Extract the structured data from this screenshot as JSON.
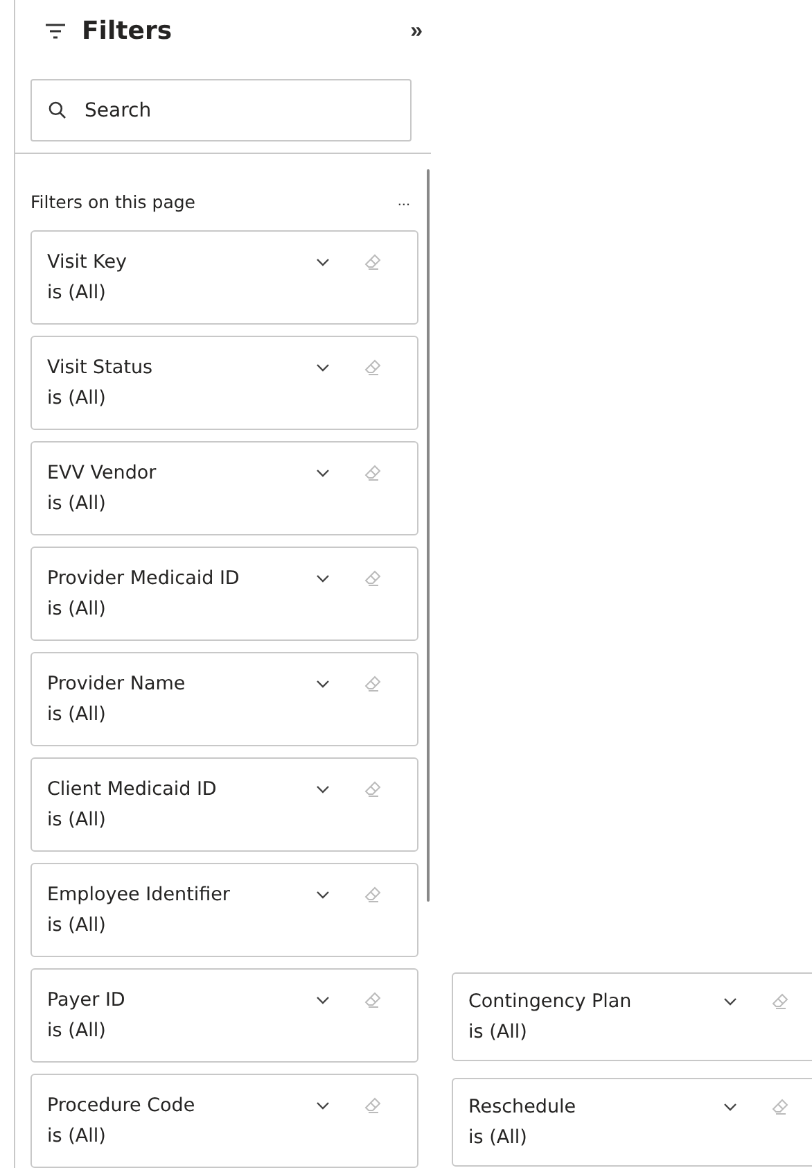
{
  "header": {
    "title": "Filters",
    "collapse": "»"
  },
  "search": {
    "placeholder": "Search"
  },
  "section": {
    "label": "Filters on this page",
    "more": "..."
  },
  "filters": [
    {
      "name": "Visit Key",
      "value": "is (All)"
    },
    {
      "name": "Visit Status",
      "value": "is (All)"
    },
    {
      "name": "EVV Vendor",
      "value": "is (All)"
    },
    {
      "name": "Provider Medicaid ID",
      "value": "is (All)"
    },
    {
      "name": "Provider Name",
      "value": "is (All)"
    },
    {
      "name": "Client Medicaid ID",
      "value": "is (All)"
    },
    {
      "name": "Employee Identifier",
      "value": "is (All)"
    },
    {
      "name": "Payer ID",
      "value": "is (All)"
    },
    {
      "name": "Procedure Code",
      "value": "is (All)"
    }
  ],
  "side_filters": [
    {
      "name": "Contingency Plan",
      "value": "is (All)"
    },
    {
      "name": "Reschedule",
      "value": "is (All)"
    }
  ]
}
